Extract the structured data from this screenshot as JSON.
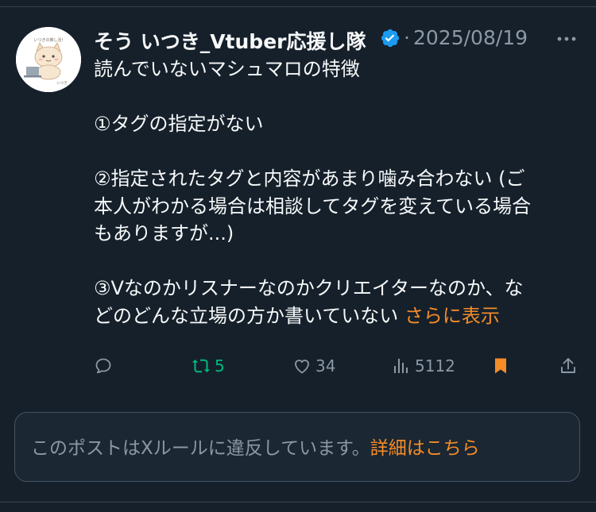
{
  "post": {
    "author_name": "そう いつき_Vtuber応援し隊",
    "separator": "·",
    "date": "2025/08/19",
    "avatar_caption_top": "いつきの推し活!",
    "avatar_caption_bottom": "いつき",
    "text_lines": [
      "読んでいないマシュマロの特徴",
      "",
      "①タグの指定がない",
      "",
      "②指定されたタグと内容があまり噛み合わない (ご",
      "本人がわかる場合は相談してタグを変えている場合",
      "もありますが...)",
      "",
      "③Vなのかリスナーなのかクリエイターなのか、な",
      "どのどんな立場の方か書いていない"
    ],
    "show_more": "さらに表示"
  },
  "actions": {
    "reply_count": "",
    "repost_count": "5",
    "like_count": "34",
    "views_count": "5112"
  },
  "notice": {
    "text": "このポストはXルールに違反しています。",
    "link": "詳細はこちら"
  },
  "colors": {
    "background": "#15202b",
    "accent": "#f48c28",
    "verified": "#1d9bf0",
    "repost": "#00ba7c",
    "muted": "#8b98a5"
  },
  "icons": [
    "verified-badge-icon",
    "more-icon",
    "reply-icon",
    "repost-icon",
    "like-icon",
    "views-icon",
    "bookmark-icon",
    "share-icon"
  ]
}
